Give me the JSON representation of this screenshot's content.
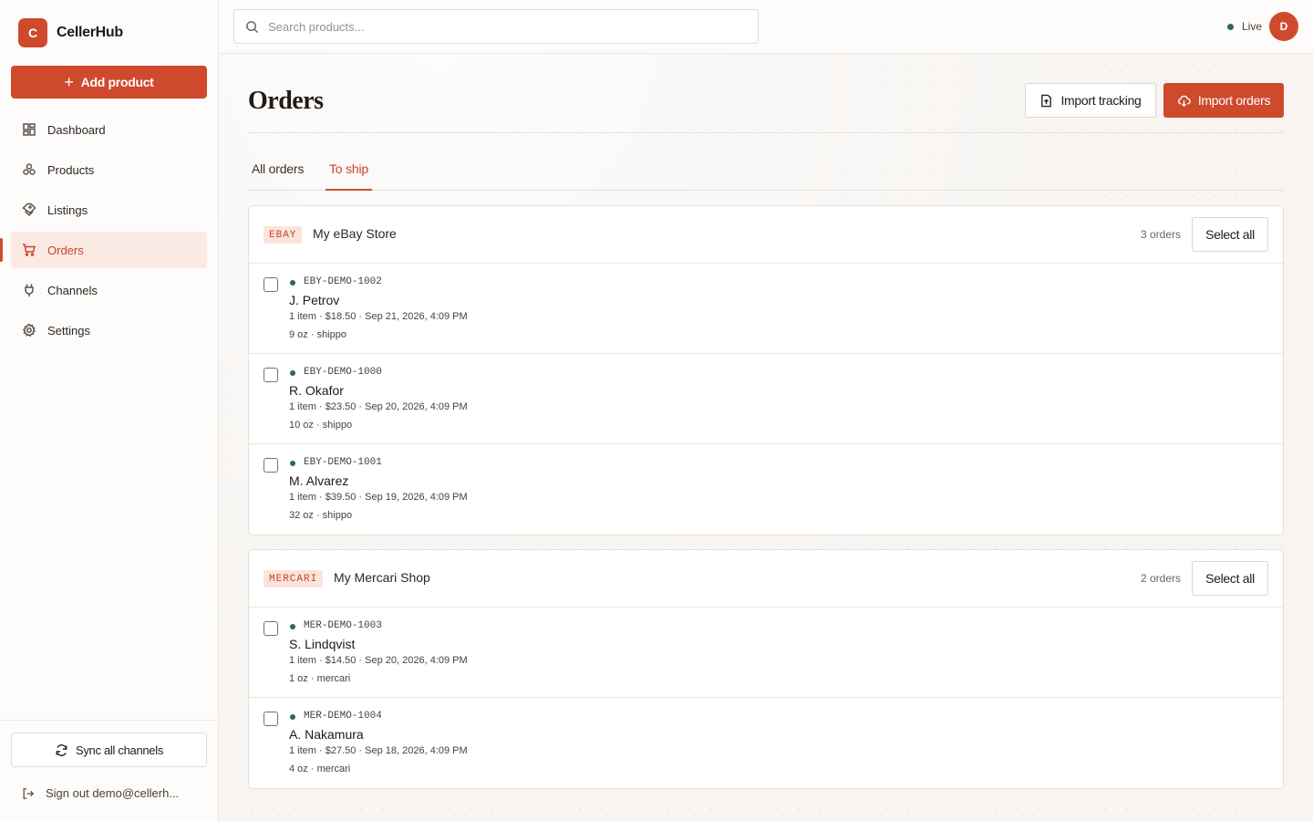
{
  "brand": {
    "logo_letter": "C",
    "name": "CellerHub"
  },
  "sidebar": {
    "add_button": "Add product",
    "items": [
      {
        "label": "Dashboard",
        "icon": "dashboard-icon"
      },
      {
        "label": "Products",
        "icon": "products-icon"
      },
      {
        "label": "Listings",
        "icon": "tag-icon"
      },
      {
        "label": "Orders",
        "icon": "cart-icon",
        "active": true
      },
      {
        "label": "Channels",
        "icon": "plug-icon"
      },
      {
        "label": "Settings",
        "icon": "gear-icon"
      }
    ],
    "sync_button": "Sync all channels",
    "signout": "Sign out demo@cellerh..."
  },
  "topbar": {
    "search_placeholder": "Search products...",
    "status": "Live",
    "avatar_letter": "D"
  },
  "page": {
    "title": "Orders",
    "import_tracking": "Import tracking",
    "import_orders": "Import orders",
    "tabs": [
      "All orders",
      "To ship"
    ],
    "active_tab": "To ship"
  },
  "stores": [
    {
      "badge": "EBAY",
      "name": "My eBay Store",
      "count": "3 orders",
      "select_all": "Select all",
      "orders": [
        {
          "id": "EBY-DEMO-1002",
          "customer": "J. Petrov",
          "meta": "1 item · $18.50 · Sep 21, 2026, 4:09 PM",
          "shipping": "9 oz · shippo"
        },
        {
          "id": "EBY-DEMO-1000",
          "customer": "R. Okafor",
          "meta": "1 item · $23.50 · Sep 20, 2026, 4:09 PM",
          "shipping": "10 oz · shippo"
        },
        {
          "id": "EBY-DEMO-1001",
          "customer": "M. Alvarez",
          "meta": "1 item · $39.50 · Sep 19, 2026, 4:09 PM",
          "shipping": "32 oz · shippo"
        }
      ]
    },
    {
      "badge": "MERCARI",
      "name": "My Mercari Shop",
      "count": "2 orders",
      "select_all": "Select all",
      "orders": [
        {
          "id": "MER-DEMO-1003",
          "customer": "S. Lindqvist",
          "meta": "1 item · $14.50 · Sep 20, 2026, 4:09 PM",
          "shipping": "1 oz · mercari"
        },
        {
          "id": "MER-DEMO-1004",
          "customer": "A. Nakamura",
          "meta": "1 item · $27.50 · Sep 18, 2026, 4:09 PM",
          "shipping": "4 oz · mercari"
        }
      ]
    }
  ],
  "colors": {
    "accent": "#cf4a2d",
    "live": "#2b6b4f",
    "active_bg": "#fbe9e3"
  }
}
